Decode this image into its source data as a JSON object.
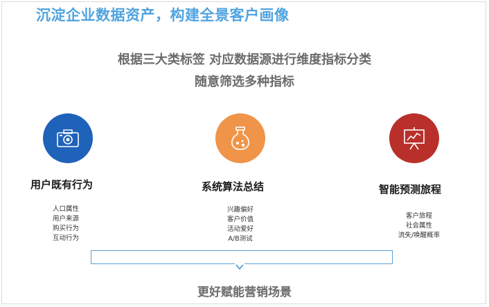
{
  "header": {
    "title": "沉淀企业数据资产，构建全景客户画像"
  },
  "intro": {
    "line1": "根据三大类标签 对应数据源进行维度指标分类",
    "line2": "随意筛选多种指标"
  },
  "categories": [
    {
      "icon": "camera-icon",
      "color": "#1f62b9",
      "heading": "用户既有行为",
      "items": [
        "人口属性",
        "用户来源",
        "购买行为",
        "互动行为"
      ]
    },
    {
      "icon": "flask-icon",
      "color": "#f0944a",
      "heading": "系统算法总结",
      "items": [
        "兴趣偏好",
        "客户价值",
        "活动爱好",
        "A/B测试"
      ]
    },
    {
      "icon": "presentation-chart-icon",
      "color": "#b9302a",
      "heading": "智能预测旅程",
      "items": [
        "客户旅程",
        "社会属性",
        "流失/唤醒概率"
      ]
    }
  ],
  "footer": {
    "text": "更好赋能营销场景"
  }
}
